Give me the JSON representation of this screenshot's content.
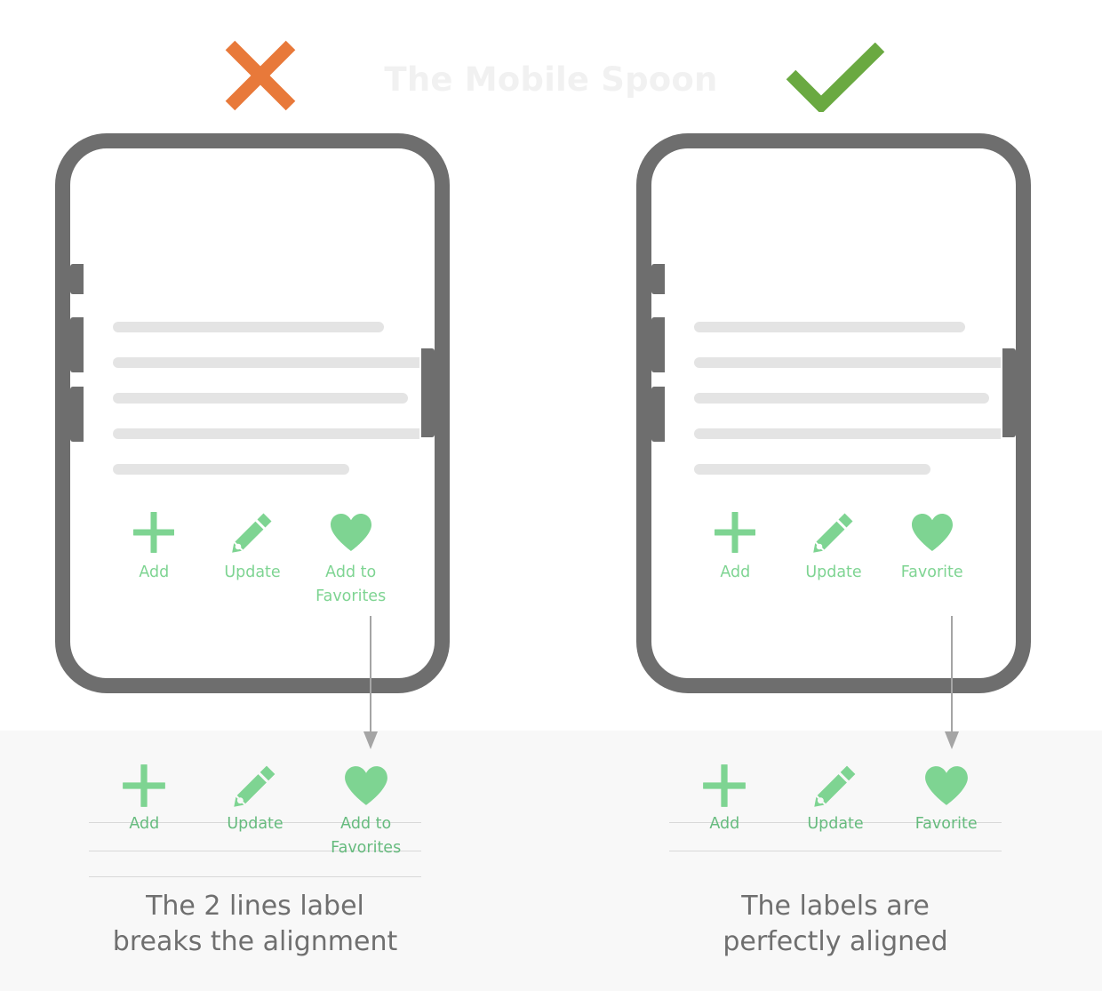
{
  "header": {
    "watermark": "The Mobile Spoon",
    "bad_icon": "cross-x-icon",
    "good_icon": "checkmark-icon",
    "bad_color": "#e8793a",
    "good_color": "#6aa941"
  },
  "theme": {
    "green": "#7ed492",
    "green_label": "#66bb7e",
    "frame_gray": "#6e6e6e",
    "placeholder_gray": "#e4e4e4",
    "panel_bg": "#f8f8f8",
    "caption_gray": "#6f6f6f",
    "guide_gray": "#d8d8d8",
    "arrow_gray": "#a5a5a5"
  },
  "placeholder_widths": [
    "305px",
    "360px",
    "332px",
    "360px",
    "266px"
  ],
  "bad_example": {
    "toolbar": [
      {
        "icon": "plus-icon",
        "label": "Add"
      },
      {
        "icon": "pencil-icon",
        "label": "Update"
      },
      {
        "icon": "heart-icon",
        "label": "Add to\nFavorites"
      }
    ],
    "detail": [
      {
        "icon": "plus-icon",
        "label": "Add"
      },
      {
        "icon": "pencil-icon",
        "label": "Update"
      },
      {
        "icon": "heart-icon",
        "label": "Add to\nFavorites"
      }
    ],
    "guide_lines": 3,
    "caption": "The 2 lines label\nbreaks the alignment"
  },
  "good_example": {
    "toolbar": [
      {
        "icon": "plus-icon",
        "label": "Add"
      },
      {
        "icon": "pencil-icon",
        "label": "Update"
      },
      {
        "icon": "heart-icon",
        "label": "Favorite"
      }
    ],
    "detail": [
      {
        "icon": "plus-icon",
        "label": "Add"
      },
      {
        "icon": "pencil-icon",
        "label": "Update"
      },
      {
        "icon": "heart-icon",
        "label": "Favorite"
      }
    ],
    "guide_lines": 2,
    "caption": "The labels are\nperfectly aligned"
  }
}
